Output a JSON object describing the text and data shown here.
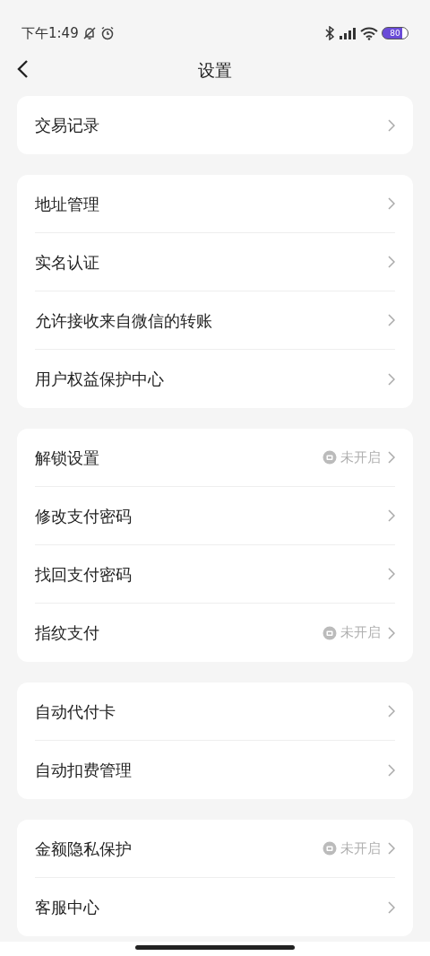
{
  "status_bar": {
    "time": "下午1:49",
    "battery": "80"
  },
  "nav": {
    "title": "设置"
  },
  "groups": [
    {
      "items": [
        {
          "label": "交易记录"
        }
      ]
    },
    {
      "items": [
        {
          "label": "地址管理"
        },
        {
          "label": "实名认证"
        },
        {
          "label": "允许接收来自微信的转账"
        },
        {
          "label": "用户权益保护中心"
        }
      ]
    },
    {
      "items": [
        {
          "label": "解锁设置",
          "status": "未开启"
        },
        {
          "label": "修改支付密码"
        },
        {
          "label": "找回支付密码"
        },
        {
          "label": "指纹支付",
          "status": "未开启"
        }
      ]
    },
    {
      "items": [
        {
          "label": "自动代付卡"
        },
        {
          "label": "自动扣费管理"
        }
      ]
    },
    {
      "items": [
        {
          "label": "金额隐私保护",
          "status": "未开启"
        },
        {
          "label": "客服中心"
        }
      ]
    }
  ]
}
